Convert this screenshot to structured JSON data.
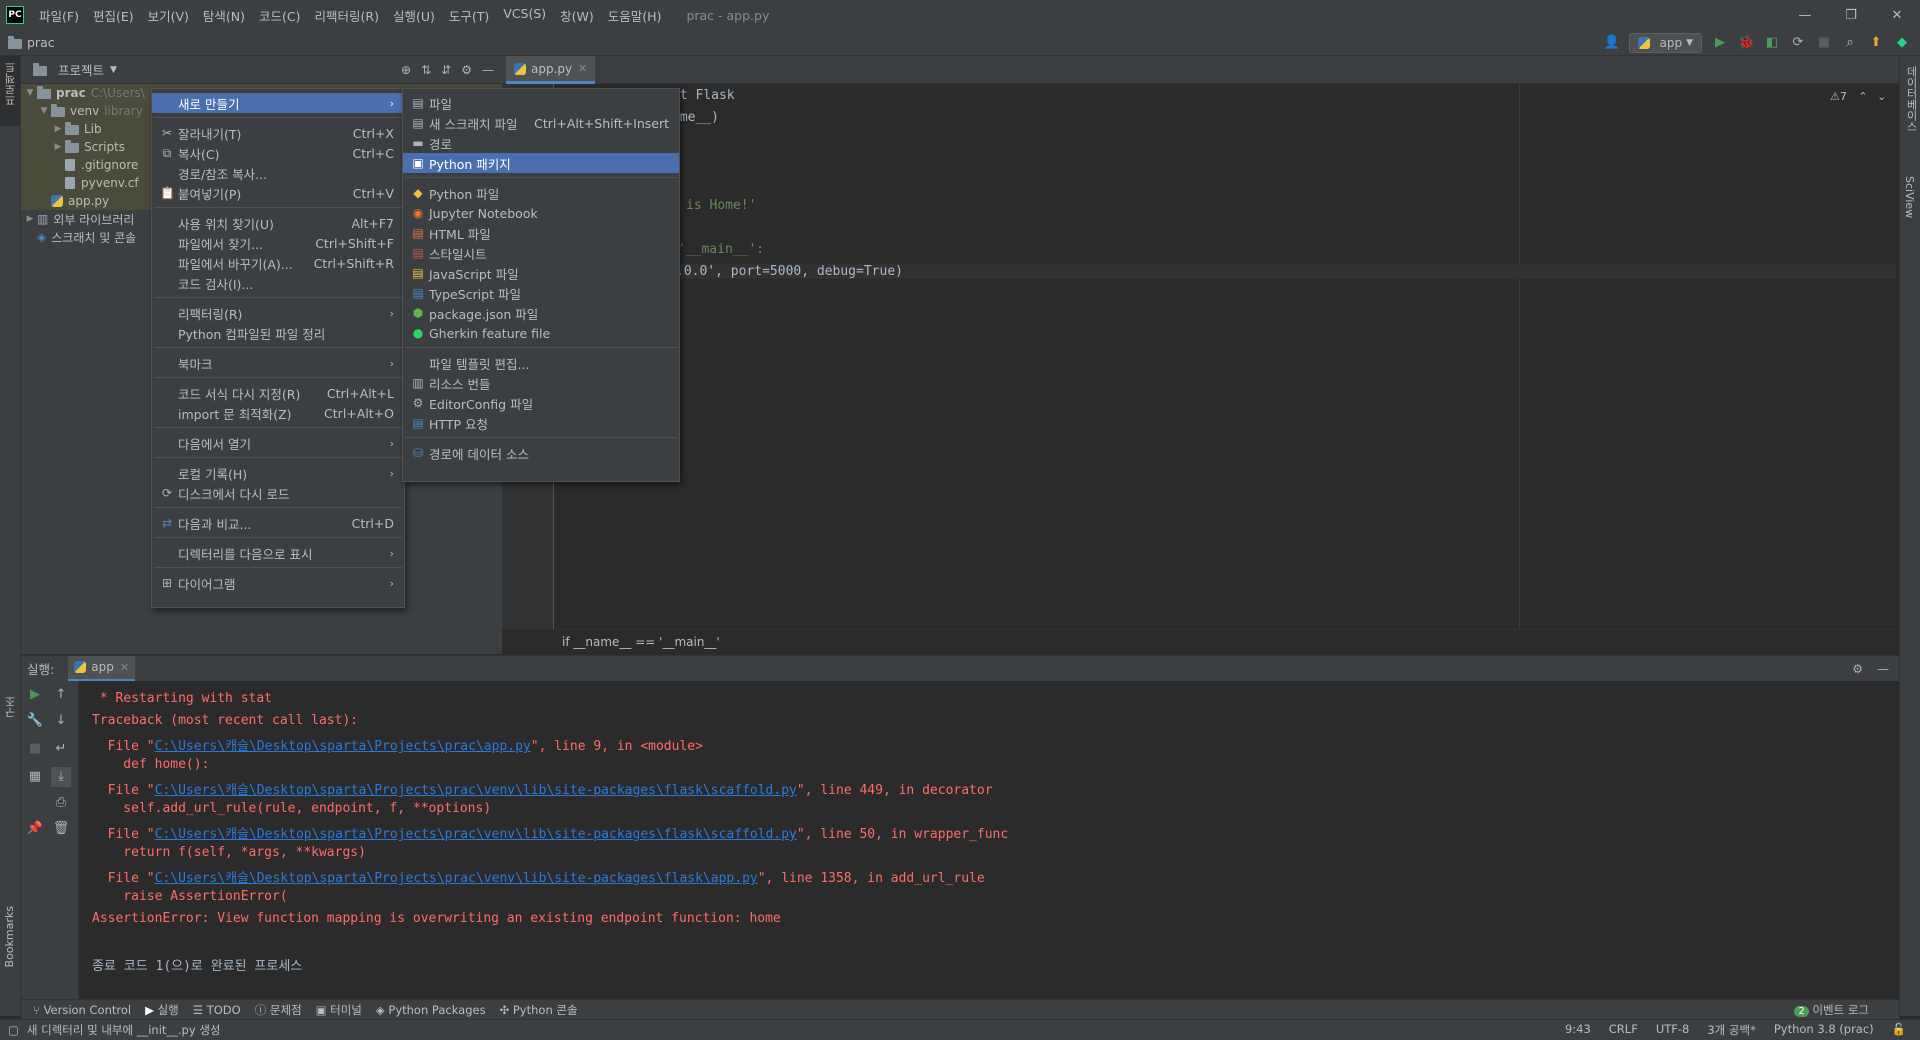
{
  "titlebar": {
    "logo": "PC",
    "menus": [
      "파일(F)",
      "편집(E)",
      "보기(V)",
      "탐색(N)",
      "코드(C)",
      "리팩터링(R)",
      "실행(U)",
      "도구(T)",
      "VCS(S)",
      "창(W)",
      "도움말(H)"
    ],
    "title": "prac - app.py",
    "minimize": "—",
    "restore": "❐",
    "close": "✕"
  },
  "navbar": {
    "project": "prac",
    "run_config": "app"
  },
  "left_strip": {
    "project": "프로젝트",
    "structure": "구조",
    "bookmarks": "Bookmarks"
  },
  "right_strip": {
    "database": "데이터베이스",
    "sciview": "SciView"
  },
  "project_panel": {
    "title": "프로젝트",
    "tree": [
      {
        "label": "prac",
        "extra": "C:\\Users\\",
        "level": 0
      },
      {
        "label": "venv",
        "extra": "library",
        "level": 1
      },
      {
        "label": "Lib",
        "extra": "",
        "level": 2
      },
      {
        "label": "Scripts",
        "extra": "",
        "level": 2
      },
      {
        "label": ".gitignore",
        "extra": "",
        "level": 2
      },
      {
        "label": "pyvenv.cf",
        "extra": "",
        "level": 2
      },
      {
        "label": "app.py",
        "extra": "",
        "level": 1
      },
      {
        "label": "외부 라이브러리",
        "extra": "",
        "level": 0
      },
      {
        "label": "스크래치 및 콘솔",
        "extra": "",
        "level": 0
      }
    ]
  },
  "editor": {
    "tab": "app.py",
    "lines": [
      {
        "text": "rt Flask"
      },
      {
        "text": "ame__)"
      },
      {
        "text": "is Home!'"
      },
      {
        "text": "'__main__':"
      },
      {
        "text": ".0.0', port=5000, debug=True)"
      }
    ],
    "warnings": "⚠7",
    "breadcrumb": "if __name__ == '__main__'"
  },
  "context_menu": {
    "items": [
      {
        "label": "새로 만들기",
        "shortcut": "",
        "submenu": true,
        "highlight": true
      },
      {
        "label": "잘라내기(T)",
        "shortcut": "Ctrl+X"
      },
      {
        "label": "복사(C)",
        "shortcut": "Ctrl+C"
      },
      {
        "label": "경로/참조 복사...",
        "shortcut": ""
      },
      {
        "label": "붙여넣기(P)",
        "shortcut": "Ctrl+V"
      },
      {
        "label": "사용 위치 찾기(U)",
        "shortcut": "Alt+F7"
      },
      {
        "label": "파일에서 찾기...",
        "shortcut": "Ctrl+Shift+F"
      },
      {
        "label": "파일에서 바꾸기(A)...",
        "shortcut": "Ctrl+Shift+R"
      },
      {
        "label": "코드 검사(I)...",
        "shortcut": ""
      },
      {
        "label": "리팩터링(R)",
        "shortcut": "",
        "submenu": true
      },
      {
        "label": "Python 컴파일된 파일 정리",
        "shortcut": ""
      },
      {
        "label": "북마크",
        "shortcut": "",
        "submenu": true
      },
      {
        "label": "코드 서식 다시 지정(R)",
        "shortcut": "Ctrl+Alt+L"
      },
      {
        "label": "import 문 최적화(Z)",
        "shortcut": "Ctrl+Alt+O"
      },
      {
        "label": "다음에서 열기",
        "shortcut": "",
        "submenu": true
      },
      {
        "label": "로컬 기록(H)",
        "shortcut": "",
        "submenu": true
      },
      {
        "label": "디스크에서 다시 로드",
        "shortcut": ""
      },
      {
        "label": "다음과 비교...",
        "shortcut": "Ctrl+D"
      },
      {
        "label": "디렉터리를 다음으로 표시",
        "shortcut": "",
        "submenu": true
      },
      {
        "label": "다이어그램",
        "shortcut": "",
        "submenu": true
      }
    ]
  },
  "new_submenu": {
    "items": [
      {
        "label": "파일",
        "shortcut": ""
      },
      {
        "label": "새 스크래치 파일",
        "shortcut": "Ctrl+Alt+Shift+Insert"
      },
      {
        "label": "경로",
        "shortcut": ""
      },
      {
        "label": "Python 패키지",
        "shortcut": "",
        "highlight": true
      },
      {
        "label": "Python 파일",
        "shortcut": ""
      },
      {
        "label": "Jupyter Notebook",
        "shortcut": ""
      },
      {
        "label": "HTML 파일",
        "shortcut": ""
      },
      {
        "label": "스타일시트",
        "shortcut": ""
      },
      {
        "label": "JavaScript 파일",
        "shortcut": ""
      },
      {
        "label": "TypeScript 파일",
        "shortcut": ""
      },
      {
        "label": "package.json 파일",
        "shortcut": ""
      },
      {
        "label": "Gherkin feature file",
        "shortcut": ""
      },
      {
        "label": "파일 템플릿 편집...",
        "shortcut": ""
      },
      {
        "label": "리소스 번들",
        "shortcut": ""
      },
      {
        "label": "EditorConfig 파일",
        "shortcut": ""
      },
      {
        "label": "HTTP 요청",
        "shortcut": ""
      },
      {
        "label": "경로에 데이터 소스",
        "shortcut": ""
      }
    ]
  },
  "run_panel": {
    "label": "실행:",
    "tab": "app",
    "console": [
      {
        "pre": " * Restarting with stat",
        "link": "",
        "post": ""
      },
      {
        "pre": "Traceback (most recent call last):",
        "link": "",
        "post": ""
      },
      {
        "pre": "  File \"",
        "link": "C:\\Users\\캐슬\\Desktop\\sparta\\Projects\\prac\\app.py",
        "post": "\", line 9, in <module>"
      },
      {
        "pre": "    def home():",
        "link": "",
        "post": ""
      },
      {
        "pre": "  File \"",
        "link": "C:\\Users\\캐슬\\Desktop\\sparta\\Projects\\prac\\venv\\lib\\site-packages\\flask\\scaffold.py",
        "post": "\", line 449, in decorator"
      },
      {
        "pre": "    self.add_url_rule(rule, endpoint, f, **options)",
        "link": "",
        "post": ""
      },
      {
        "pre": "  File \"",
        "link": "C:\\Users\\캐슬\\Desktop\\sparta\\Projects\\prac\\venv\\lib\\site-packages\\flask\\scaffold.py",
        "post": "\", line 50, in wrapper_func"
      },
      {
        "pre": "    return f(self, *args, **kwargs)",
        "link": "",
        "post": ""
      },
      {
        "pre": "  File \"",
        "link": "C:\\Users\\캐슬\\Desktop\\sparta\\Projects\\prac\\venv\\lib\\site-packages\\flask\\app.py",
        "post": "\", line 1358, in add_url_rule"
      },
      {
        "pre": "    raise AssertionError(",
        "link": "",
        "post": ""
      },
      {
        "pre": "AssertionError: View function mapping is overwriting an existing endpoint function: home",
        "link": "",
        "post": ""
      },
      {
        "pre": "",
        "link": "",
        "post": ""
      },
      {
        "pre": "종료 코드 1(으)로 완료된 프로세스",
        "link": "",
        "post": ""
      }
    ]
  },
  "tool_tabs": [
    "Version Control",
    "실행",
    "TODO",
    "문제점",
    "터미널",
    "Python Packages",
    "Python 콘솔"
  ],
  "event_log": {
    "count": "2",
    "label": "이벤트 로그"
  },
  "statusbar": {
    "message": "새 디렉터리 및 내부에 __init__.py 생성",
    "position": "9:43",
    "line_sep": "CRLF",
    "encoding": "UTF-8",
    "indent": "3개 공백*",
    "interpreter": "Python 3.8 (prac)"
  },
  "colors": {
    "accent": "#4a88c7",
    "highlight": "#4b6eaf",
    "error": "#ff6b68",
    "link": "#287bde"
  }
}
